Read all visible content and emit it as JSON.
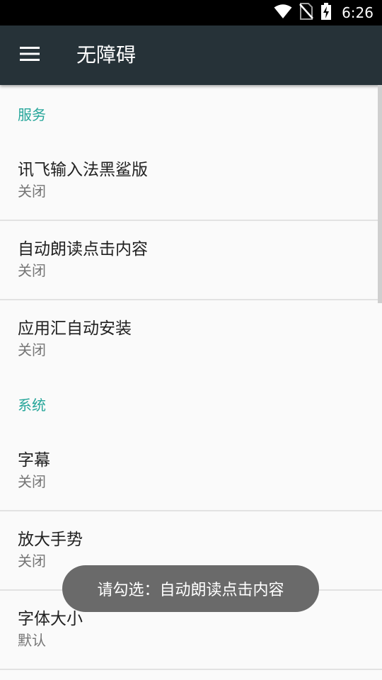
{
  "status_bar": {
    "time": "6:26",
    "icons": [
      "wifi-icon",
      "no-sim-icon",
      "battery-charging-icon"
    ]
  },
  "app_bar": {
    "title": "无障碍",
    "menu_icon": "hamburger-menu-icon",
    "background_color": "#263238"
  },
  "sections": [
    {
      "category": "服务",
      "items": [
        {
          "title": "讯飞输入法黑鲨版",
          "summary": "关闭"
        },
        {
          "title": "自动朗读点击内容",
          "summary": "关闭"
        },
        {
          "title": "应用汇自动安装",
          "summary": "关闭"
        }
      ]
    },
    {
      "category": "系统",
      "items": [
        {
          "title": "字幕",
          "summary": "关闭"
        },
        {
          "title": "放大手势",
          "summary": "关闭"
        },
        {
          "title": "字体大小",
          "summary": "默认"
        }
      ]
    }
  ],
  "toast": {
    "text": "请勾选：自动朗读点击内容"
  },
  "accent_color": "#26a69a"
}
